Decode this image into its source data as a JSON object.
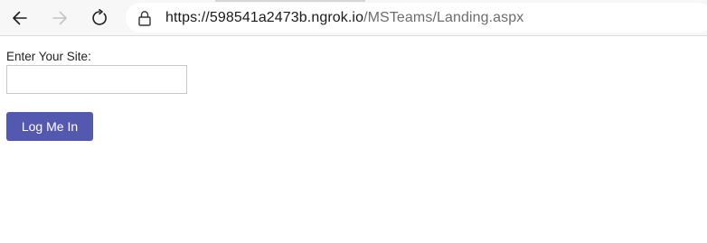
{
  "browser": {
    "back_icon": "arrow-left-icon",
    "forward_icon": "arrow-right-icon",
    "refresh_icon": "refresh-icon",
    "lock_icon": "lock-icon",
    "url_host": "https://598541a2473b.ngrok.io",
    "url_path": "/MSTeams/Landing.aspx"
  },
  "form": {
    "site_label": "Enter Your Site:",
    "site_value": "",
    "login_label": "Log Me In"
  },
  "colors": {
    "button_bg": "#5558af",
    "button_text": "#ffffff"
  }
}
